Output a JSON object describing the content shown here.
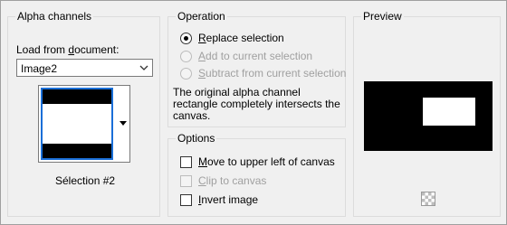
{
  "alpha_channels": {
    "title": "Alpha channels",
    "load_from_label_prefix": "Load from ",
    "load_from_label_underlined": "d",
    "load_from_label_suffix": "ocument:",
    "document_value": "Image2",
    "thumbnail_caption": "Sélection #2"
  },
  "operation": {
    "title": "Operation",
    "options": [
      {
        "prefix": "",
        "underlined": "R",
        "suffix": "eplace selection",
        "selected": true,
        "enabled": true
      },
      {
        "prefix": "",
        "underlined": "A",
        "suffix": "dd to current selection",
        "selected": false,
        "enabled": false
      },
      {
        "prefix": "",
        "underlined": "S",
        "suffix": "ubtract from current selection",
        "selected": false,
        "enabled": false
      }
    ],
    "description_lines": [
      "The original alpha channel",
      "rectangle completely intersects the",
      "canvas."
    ]
  },
  "options": {
    "title": "Options",
    "checkboxes": [
      {
        "prefix": "",
        "underlined": "M",
        "suffix": "ove to upper left of canvas",
        "checked": false,
        "enabled": true
      },
      {
        "prefix": "",
        "underlined": "C",
        "suffix": "lip to canvas",
        "checked": false,
        "enabled": false
      },
      {
        "prefix": "",
        "underlined": "I",
        "suffix": "nvert image",
        "checked": false,
        "enabled": true
      }
    ]
  },
  "preview": {
    "title": "Preview",
    "checker_icon": "transparency-checker-icon"
  }
}
